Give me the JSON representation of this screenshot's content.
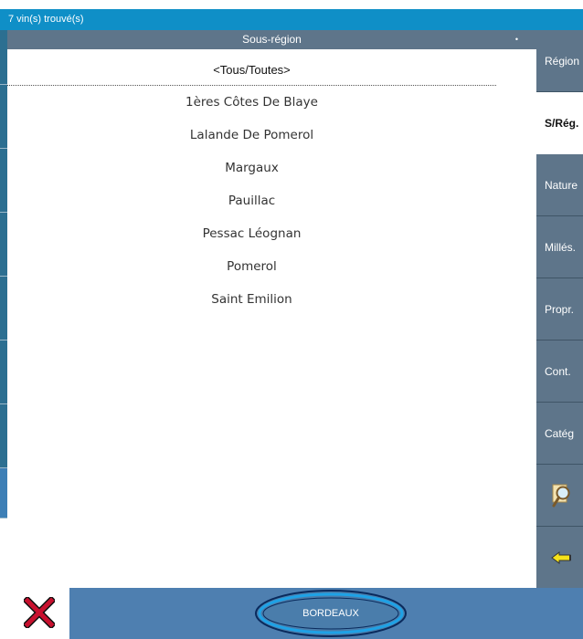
{
  "status": {
    "text": "7 vin(s) trouvé(s)"
  },
  "header": {
    "title": "Sous-région",
    "dot": "•"
  },
  "list": {
    "all_label": "<Tous/Toutes>",
    "items": [
      "1ères Côtes De Blaye",
      "Lalande De Pomerol",
      "Margaux",
      "Pauillac",
      "Pessac Léognan",
      "Pomerol",
      "Saint Emilion"
    ]
  },
  "sidebar": {
    "items": [
      {
        "label": "Région",
        "active": false
      },
      {
        "label": "S/Rég.",
        "active": true
      },
      {
        "label": "Nature",
        "active": false
      },
      {
        "label": "Millés.",
        "active": false
      },
      {
        "label": "Propr.",
        "active": false
      },
      {
        "label": "Cont.",
        "active": false
      },
      {
        "label": "Catég",
        "active": false
      }
    ],
    "icons": [
      "magnifier-icon",
      "arrow-left-icon"
    ]
  },
  "bottom": {
    "region_label": "BORDEAUX",
    "close_icon": "close-icon"
  },
  "colors": {
    "status_bar": "#0f8fc7",
    "header": "#5e758a",
    "sidebar_button": "#5e758a",
    "bottom_bar": "#4e7fb0",
    "close_x": "#c8102e"
  }
}
